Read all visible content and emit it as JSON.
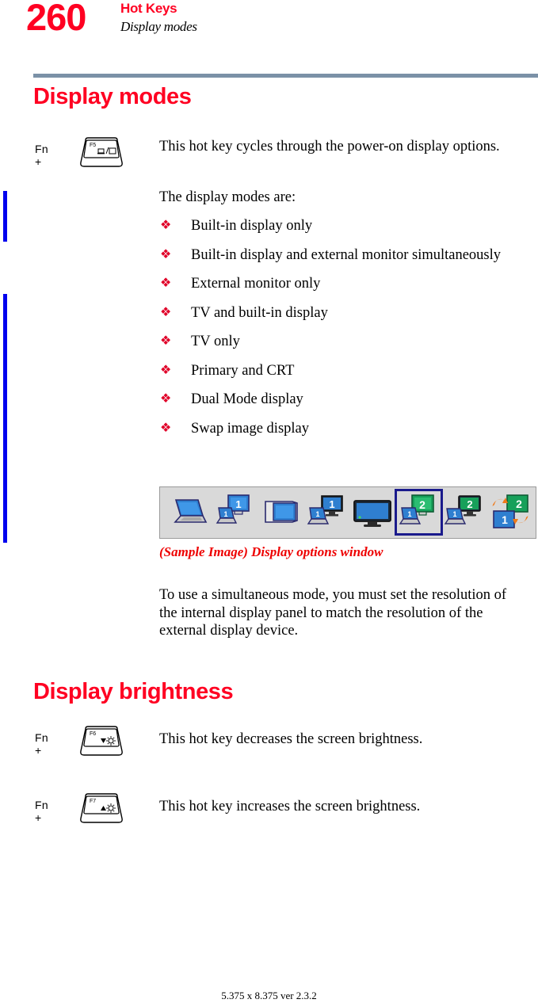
{
  "header": {
    "folio": "260",
    "title": "Hot Keys",
    "subtitle": "Display modes"
  },
  "sections": {
    "display_modes": {
      "heading": "Display modes",
      "fn_label": "Fn +",
      "key": {
        "name": "F5",
        "glyph": "display-toggle",
        "label": "F5"
      },
      "intro": "This hot key cycles through the power-on display options.",
      "lead_in": "The display modes are:",
      "bullet_marker": "❖",
      "modes": [
        "Built-in display only",
        "Built-in display and external monitor simultaneously",
        "External monitor only",
        "TV and built-in display",
        "TV only",
        "Primary and CRT",
        "Dual Mode display",
        "Swap image display"
      ],
      "figure": {
        "caption": "(Sample Image) Display options window",
        "icons": [
          {
            "name": "laptop-only",
            "badge": "",
            "selected": false
          },
          {
            "name": "laptop-and-monitor-clone",
            "badge": "1",
            "badge2": "1",
            "selected": false
          },
          {
            "name": "external-monitor-only",
            "badge": "",
            "selected": false
          },
          {
            "name": "laptop-and-monitor-primary",
            "badge": "1",
            "badge2": "1",
            "selected": false
          },
          {
            "name": "tv-only",
            "badge": "",
            "selected": false
          },
          {
            "name": "laptop-and-monitor-extended",
            "badge": "1",
            "badge2": "2",
            "selected": true
          },
          {
            "name": "laptop-and-tv-extended",
            "badge": "1",
            "badge2": "2",
            "selected": false
          },
          {
            "name": "swap-displays",
            "badge": "1",
            "badge2": "2",
            "selected": false
          }
        ]
      },
      "note": "To use a simultaneous mode, you must set the resolution of the internal display panel to match the resolution of the external display device."
    },
    "display_brightness": {
      "heading": "Display brightness",
      "rows": [
        {
          "fn_label": "Fn +",
          "key": {
            "name": "F6",
            "glyph": "brightness-down",
            "label": "F6"
          },
          "text": "This hot key decreases the screen brightness."
        },
        {
          "fn_label": "Fn +",
          "key": {
            "name": "F7",
            "glyph": "brightness-up",
            "label": "F7"
          },
          "text": "This hot key increases the screen brightness."
        }
      ]
    }
  },
  "footer": {
    "text": "5.375 x 8.375 ver 2.3.2"
  },
  "colors": {
    "accent_red": "#ff0022",
    "caption_red": "#ee0000",
    "rule_slate": "#7b91a7",
    "change_bar_blue": "#0000ee",
    "selection_navy": "#1a1a8c"
  }
}
